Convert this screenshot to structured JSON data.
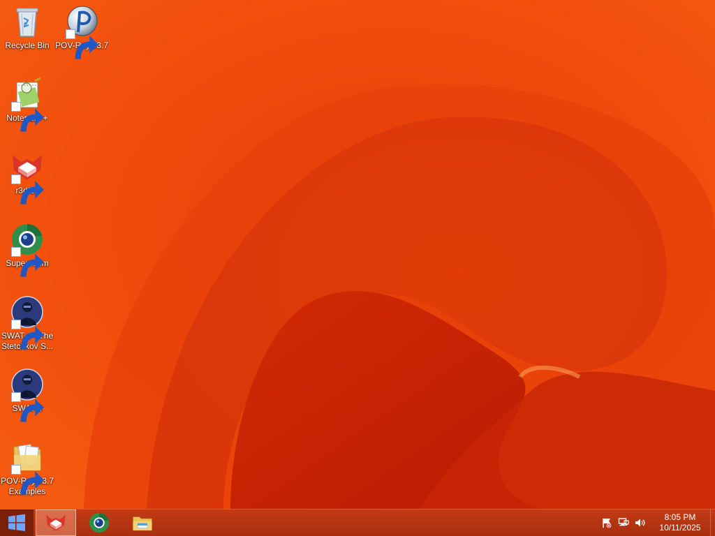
{
  "desktop": {
    "icons": [
      {
        "label": "Recycle Bin",
        "icon": "recycle-bin-icon",
        "shortcut": false
      },
      {
        "label": "POV-Ray v3.7",
        "icon": "povray-icon",
        "shortcut": true
      },
      {
        "label": "Notepad++",
        "icon": "notepadpp-icon",
        "shortcut": true
      },
      {
        "label": "r3dfox",
        "icon": "r3dfox-icon",
        "shortcut": true
      },
      {
        "label": "Supermium",
        "icon": "supermium-icon",
        "shortcut": true
      },
      {
        "label": "SWAT 4 - The Stetchkov S...",
        "icon": "swat4-tsk-icon",
        "shortcut": true
      },
      {
        "label": "SWAT 4",
        "icon": "swat4-icon",
        "shortcut": true
      },
      {
        "label": "POV-Ray v3.7 Examples",
        "icon": "folder-icon",
        "shortcut": true
      }
    ],
    "wallpaper_colors": {
      "base": "#f04a0a",
      "dark": "#c81e04",
      "light": "#ff7a2a"
    }
  },
  "taskbar": {
    "start_icon": "windows-logo-icon",
    "pinned": [
      {
        "name": "r3dfox",
        "icon": "r3dfox-icon",
        "active": true
      },
      {
        "name": "Supermium",
        "icon": "supermium-icon",
        "active": false
      },
      {
        "name": "File Explorer",
        "icon": "file-explorer-icon",
        "active": false
      }
    ],
    "tray": {
      "icons": [
        "action-center-flag-icon",
        "network-icon",
        "volume-icon"
      ],
      "time": "8:05 PM",
      "date": "10/11/2025"
    },
    "colors": {
      "bar": "#b3330f",
      "start": "#7a1f08"
    }
  }
}
